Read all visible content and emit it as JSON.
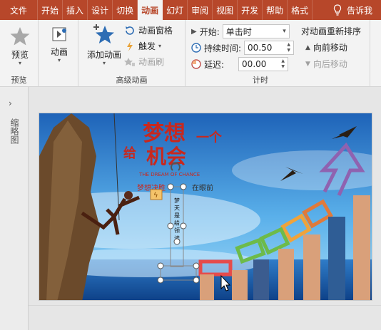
{
  "tabs": [
    "文件",
    "开始",
    "插入",
    "设计",
    "切换",
    "动画",
    "幻灯片放映",
    "审阅",
    "视图",
    "开发工具",
    "帮助",
    "格式"
  ],
  "tabs_display": [
    "文件",
    "开始",
    "插入",
    "设计",
    "切换",
    "动画",
    "幻灯",
    "审阅",
    "视图",
    "开发",
    "帮助",
    "格式"
  ],
  "tell_me": "告诉我",
  "preview_group": {
    "button": "预览",
    "label": "预览"
  },
  "animation_group": {
    "button": "动画"
  },
  "advanced_group": {
    "add_animation": "添加动画",
    "animation_pane": "动画窗格",
    "trigger": "触发",
    "animation_painter": "动画刷",
    "label": "高级动画"
  },
  "timing_group": {
    "start_label": "开始:",
    "start_value": "单击时",
    "duration_label": "持续时间:",
    "duration_value": "00.50",
    "delay_label": "延迟:",
    "delay_value": "00.00",
    "reorder_title": "对动画重新排序",
    "move_earlier": "向前移动",
    "move_later": "向后移动",
    "label": "计时"
  },
  "nav_pane": {
    "label": "缩略图"
  },
  "slide": {
    "title_main": "梦想",
    "title_pre": "给",
    "title_yi": "一个",
    "title_chance": "机会",
    "subtitle_en": "THE DREAM OF CHANCE",
    "tagline_left": "梦想决胜",
    "tagline_right": "在眼前",
    "vertical_text": "梦 天 是 给 领 读",
    "anim_marker": "1"
  },
  "colors": {
    "accent": "#b7472a",
    "star": "#2e6db4",
    "sky_top": "#1e63b8",
    "sky_bottom": "#8fd2f5"
  }
}
